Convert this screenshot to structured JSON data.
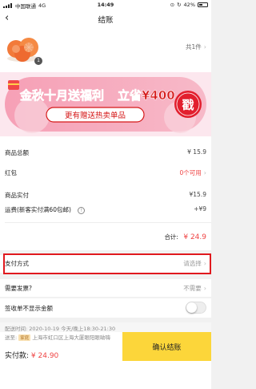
{
  "status_bar": {
    "carrier": "中国联通",
    "network": "4G",
    "time": "14:49",
    "battery": "42%"
  },
  "nav": {
    "title": "结账"
  },
  "product": {
    "badge": "1",
    "count_text": "共1件"
  },
  "banner": {
    "headline_part1": "金秋十月送福利",
    "headline_part2": "立省¥400",
    "subline": "更有赠送热卖单品",
    "stamp": "戳"
  },
  "summary": {
    "product_total_label": "商品总额",
    "product_total_value": "¥ 15.9",
    "red_packet_label": "红包",
    "red_packet_value": "0个可用",
    "actual_label": "商品实付",
    "actual_value": "¥15.9",
    "shipping_label": "运费(新客实付满60包邮)",
    "shipping_value": "+¥9",
    "total_label": "合计:",
    "total_value": "¥ 24.9"
  },
  "payment": {
    "label": "支付方式",
    "placeholder": "请选择"
  },
  "invoice": {
    "label": "需要发票?",
    "value": "不需要"
  },
  "signature": {
    "label": "签收单不显示金额"
  },
  "delivery": {
    "time_label": "配送时间:",
    "time_value": "2020-10-19 今天/晚上18:30-21:30",
    "addr_label": "送至:",
    "addr_tag": "家庭",
    "addr_value": "上海市虹口区上海大厦眼阳眼呦嗨"
  },
  "footer": {
    "pay_label": "实付款:",
    "pay_amount": "¥ 24.90",
    "confirm_label": "确认结账"
  },
  "colors": {
    "accent_red": "#ef4444",
    "confirm_yellow": "#fcd63a",
    "highlight_box": "#e0191e"
  }
}
